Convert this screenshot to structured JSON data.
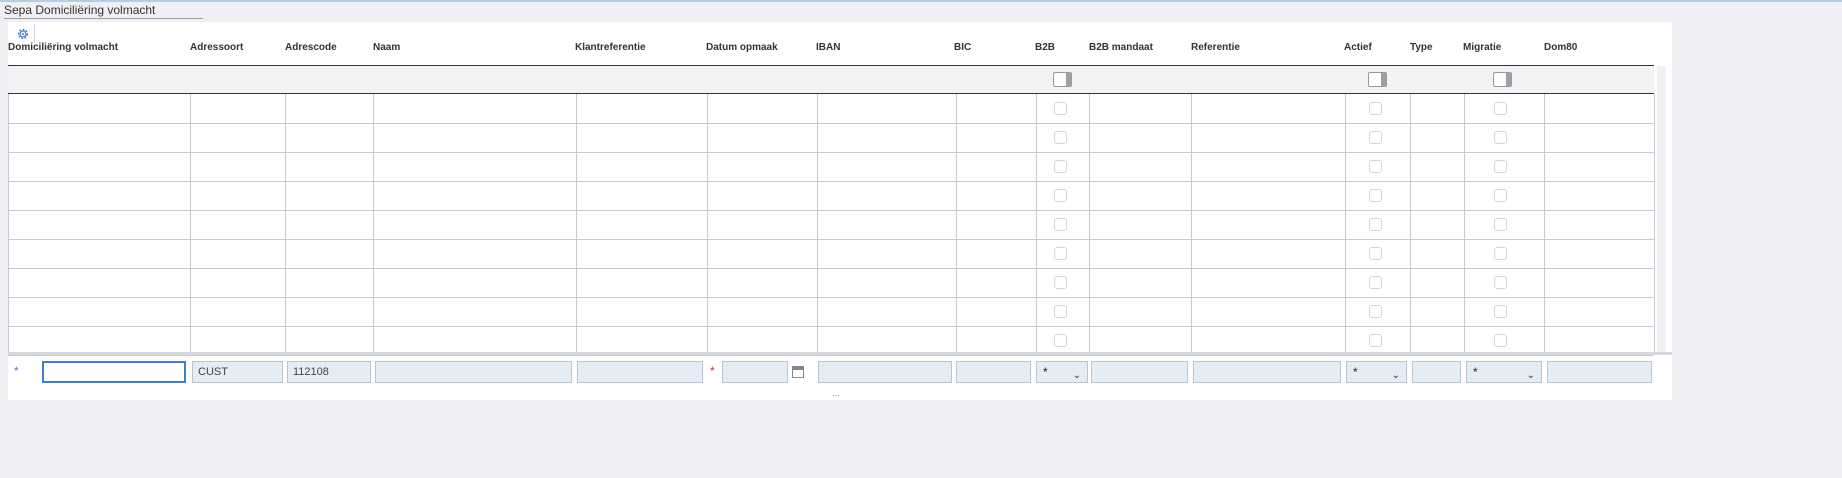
{
  "window": {
    "title": "Sepa Domiciliëring volmacht"
  },
  "toolbar": {
    "settings_icon": "gear-icon"
  },
  "columns": [
    {
      "key": "dom_volmacht",
      "label": "Domiciliëring volmacht"
    },
    {
      "key": "adressoort",
      "label": "Adressoort"
    },
    {
      "key": "adrescode",
      "label": "Adrescode"
    },
    {
      "key": "naam",
      "label": "Naam"
    },
    {
      "key": "klantreferentie",
      "label": "Klantreferentie"
    },
    {
      "key": "datum_opmaak",
      "label": "Datum opmaak"
    },
    {
      "key": "iban",
      "label": "IBAN"
    },
    {
      "key": "bic",
      "label": "BIC"
    },
    {
      "key": "b2b",
      "label": "B2B"
    },
    {
      "key": "b2b_mandaat",
      "label": "B2B mandaat"
    },
    {
      "key": "referentie",
      "label": "Referentie"
    },
    {
      "key": "actief",
      "label": "Actief"
    },
    {
      "key": "type",
      "label": "Type"
    },
    {
      "key": "migratie",
      "label": "Migratie"
    },
    {
      "key": "dom80",
      "label": "Dom80"
    }
  ],
  "rows_count_label": "",
  "new_row": {
    "dom_volmacht": "",
    "adressoort": "CUST",
    "adrescode": "112108",
    "naam": "",
    "klantreferentie": "",
    "datum_opmaak": "",
    "iban": "",
    "bic": "",
    "b2b": "*",
    "b2b_mandaat": "",
    "referentie": "",
    "actief": "*",
    "type": "",
    "migratie": "*",
    "dom80": ""
  },
  "required_marker": "*",
  "colors": {
    "accent": "#3f7fc4",
    "required": "#c0392b",
    "field_bg": "#e4edf3"
  }
}
